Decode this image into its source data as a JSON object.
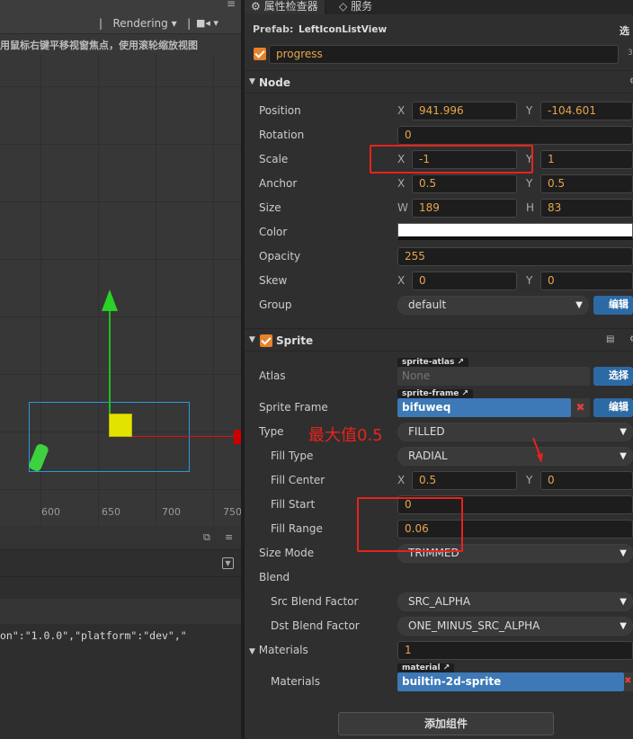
{
  "scene": {
    "rendering_label": "Rendering",
    "separator": "|",
    "hint": "用鼠标右键平移视窗焦点，使用滚轮缩放视图",
    "ticks": [
      "600",
      "650",
      "700",
      "750"
    ],
    "menu_glyph": "≡"
  },
  "console": {
    "log_line": "on\":\"1.0.0\",\"platform\":\"dev\",\""
  },
  "tabs": {
    "properties": "属性检查器",
    "service": "服务"
  },
  "prefab": {
    "label": "Prefab:",
    "name": "LeftIconListView",
    "select": "选"
  },
  "node_name": "progress",
  "node_badge": "3",
  "node": {
    "title": "Node",
    "position": {
      "label": "Position",
      "x": "941.996",
      "y": "-104.601"
    },
    "rotation": {
      "label": "Rotation",
      "value": "0"
    },
    "scale": {
      "label": "Scale",
      "x": "-1",
      "y": "1"
    },
    "anchor": {
      "label": "Anchor",
      "x": "0.5",
      "y": "0.5"
    },
    "size": {
      "label": "Size",
      "w": "189",
      "h": "83"
    },
    "color": {
      "label": "Color",
      "value": "#ffffff"
    },
    "opacity": {
      "label": "Opacity",
      "value": "255"
    },
    "skew": {
      "label": "Skew",
      "x": "0",
      "y": "0"
    },
    "group": {
      "label": "Group",
      "value": "default",
      "edit": "编辑"
    }
  },
  "axes": {
    "x": "X",
    "y": "Y",
    "w": "W",
    "h": "H"
  },
  "sprite": {
    "title": "Sprite",
    "atlas": {
      "label": "Atlas",
      "tag": "sprite-atlas",
      "value": "None",
      "button": "选择"
    },
    "sprite_frame": {
      "label": "Sprite Frame",
      "tag": "sprite-frame",
      "value": "bifuweq",
      "button": "编辑"
    },
    "type": {
      "label": "Type",
      "value": "FILLED"
    },
    "fill_type": {
      "label": "Fill Type",
      "value": "RADIAL"
    },
    "fill_center": {
      "label": "Fill Center",
      "x": "0.5",
      "y": "0"
    },
    "fill_start": {
      "label": "Fill Start",
      "value": "0"
    },
    "fill_range": {
      "label": "Fill Range",
      "value": "0.06"
    },
    "size_mode": {
      "label": "Size Mode",
      "value": "TRIMMED"
    },
    "blend": {
      "label": "Blend"
    },
    "src_blend": {
      "label": "Src Blend Factor",
      "value": "SRC_ALPHA"
    },
    "dst_blend": {
      "label": "Dst Blend Factor",
      "value": "ONE_MINUS_SRC_ALPHA"
    },
    "materials_count": {
      "label": "Materials",
      "value": "1"
    },
    "materials": {
      "label": "Materials",
      "tag": "material",
      "value": "builtin-2d-sprite"
    }
  },
  "add_component": "添加组件",
  "annotation": "最大值0.5",
  "colors": {
    "accent": "#e8822a",
    "annotation": "#e8231b",
    "button": "#2c6aa5",
    "value_text": "#e6a54d"
  }
}
